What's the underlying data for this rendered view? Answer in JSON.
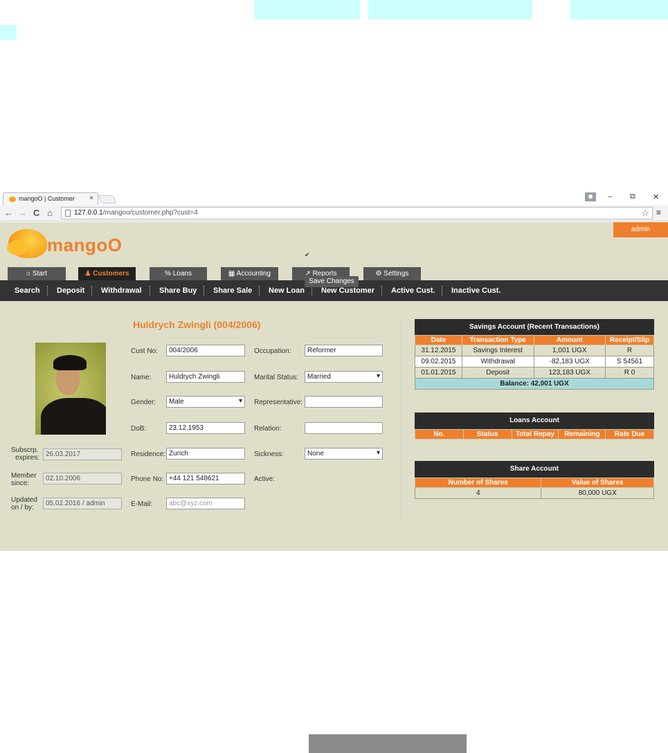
{
  "browser": {
    "tab_title": "mangoO | Customer",
    "tab_close": "×",
    "url_host": "127.0.0.1",
    "url_path": "/mangoo/customer.php?cust=4",
    "back": "←",
    "forward": "→",
    "reload": "C",
    "home": "⌂",
    "star": "☆",
    "menu": "≡",
    "minimize": "–",
    "restore": "⧉",
    "close": "✕"
  },
  "header": {
    "user": "admin",
    "logo": "mangoO"
  },
  "main_nav": [
    {
      "label": "⌂ Start"
    },
    {
      "label": "♟ Customers"
    },
    {
      "label": "% Loans"
    },
    {
      "label": "▦ Accounting"
    },
    {
      "label": "↗ Reports"
    },
    {
      "label": "⚙ Settings"
    }
  ],
  "sub_nav": [
    "Search",
    "Deposit",
    "Withdrawal",
    "Share Buy",
    "Share Sale",
    "New Loan",
    "New Customer",
    "Active Cust.",
    "Inactive Cust."
  ],
  "customer": {
    "title": "Huldrych Zwingli (004/2006)",
    "fields": {
      "cust_no": {
        "label": "Cust No:",
        "value": "004/2006"
      },
      "name": {
        "label": "Name:",
        "value": "Huldrych Zwingli"
      },
      "gender": {
        "label": "Gender:",
        "value": "Male"
      },
      "dob": {
        "label": "DoB:",
        "value": "23.12.1953"
      },
      "residence": {
        "label": "Residence:",
        "value": "Zurich"
      },
      "phone": {
        "label": "Phone No:",
        "value": "+44 121 548621"
      },
      "email": {
        "label": "E-Mail:",
        "placeholder": "abc@xyz.com"
      },
      "occupation": {
        "label": "Occupation:",
        "value": "Reformer"
      },
      "marital": {
        "label": "Marital Status:",
        "value": "Married"
      },
      "representative": {
        "label": "Representative:",
        "value": ""
      },
      "relation": {
        "label": "Relation:",
        "value": ""
      },
      "sickness": {
        "label": "Sickness:",
        "value": "None"
      },
      "active": {
        "label": "Active:",
        "checked": true
      },
      "subscr": {
        "label1": "Subscrp.",
        "label2": "expires:",
        "value": "26.03.2017"
      },
      "member": {
        "label1": "Member",
        "label2": "since:",
        "value": "02.10.2006"
      },
      "updated": {
        "label1": "Updated",
        "label2": "on / by:",
        "value": "05.02.2016 / admin"
      }
    },
    "save_label": "Save Changes",
    "check_mark": "✔"
  },
  "savings": {
    "title": "Savings Account (Recent Transactions)",
    "columns": [
      "Date",
      "Transaction Type",
      "Amount",
      "Receipt/Slip"
    ],
    "rows": [
      [
        "31.12.2015",
        "Savings Interest",
        "1,001 UGX",
        "R"
      ],
      [
        "09.02.2015",
        "Withdrawal",
        "-82,183 UGX",
        "S 54561"
      ],
      [
        "01.01.2015",
        "Deposit",
        "123,183 UGX",
        "R 0"
      ]
    ],
    "balance": "Balance: 42,001 UGX"
  },
  "loans": {
    "title": "Loans Account",
    "columns": [
      "No.",
      "Status",
      "Total Repay",
      "Remaining",
      "Rate Due"
    ]
  },
  "shares": {
    "title": "Share Account",
    "columns": [
      "Number of Shares",
      "Value of Shares"
    ],
    "row": [
      "4",
      "80,000 UGX"
    ]
  }
}
